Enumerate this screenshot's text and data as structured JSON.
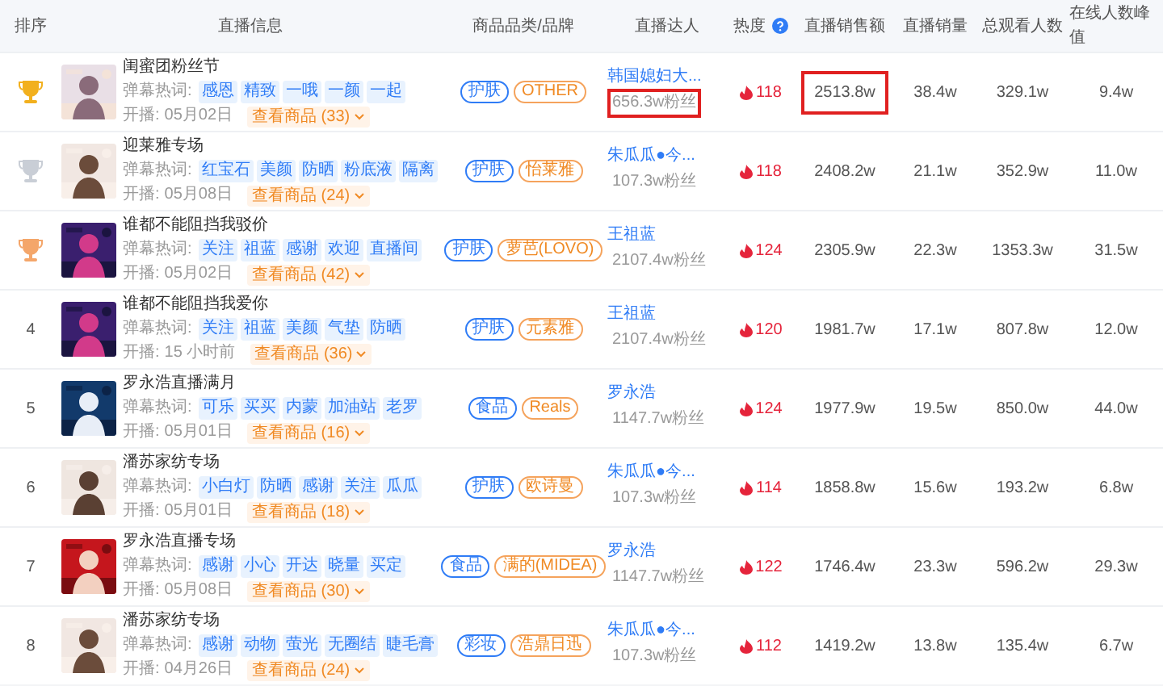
{
  "columns": [
    "排序",
    "直播信息",
    "商品品类/品牌",
    "直播达人",
    "热度",
    "直播销售额",
    "直播销量",
    "总观看人数",
    "在线人数峰值"
  ],
  "rows": [
    {
      "color": "#f2b01e",
      "title": "闺蜜团粉丝节",
      "hot_words_label": "弹幕热词:",
      "tags": [
        "感恩",
        "精致",
        "一哦",
        "一颜",
        "一起"
      ],
      "start_label": "开播:",
      "start": "05月02日",
      "goods": "查看商品 (33)",
      "category": "护肤",
      "brand": "OTHER",
      "anchor": "韩国媳妇大...",
      "fans": "656.3w粉丝",
      "fans_marked": true,
      "heat": "118",
      "sales": "2513.8w",
      "sales_marked": true,
      "volume": "38.4w",
      "viewers": "329.1w",
      "peak": "9.4w"
    },
    {
      "color": "#c9ced6",
      "title": "迎莱雅专场",
      "hot_words_label": "弹幕热词:",
      "tags": [
        "红宝石",
        "美颜",
        "防晒",
        "粉底液",
        "隔离"
      ],
      "start_label": "开播:",
      "start": "05月08日",
      "goods": "查看商品 (24)",
      "category": "护肤",
      "brand": "怡莱雅",
      "anchor": "朱瓜瓜●今...",
      "fans": "107.3w粉丝",
      "fans_marked": false,
      "heat": "118",
      "sales": "2408.2w",
      "sales_marked": false,
      "volume": "21.1w",
      "viewers": "352.9w",
      "peak": "11.0w"
    },
    {
      "color": "#f4a66a",
      "title": "谁都不能阻挡我驳价",
      "hot_words_label": "弹幕热词:",
      "tags": [
        "关注",
        "祖蓝",
        "感谢",
        "欢迎",
        "直播间"
      ],
      "start_label": "开播:",
      "start": "05月02日",
      "goods": "查看商品 (42)",
      "category": "护肤",
      "brand": "萝芭(LOVO)",
      "anchor": "王祖蓝",
      "fans": "2107.4w粉丝",
      "fans_marked": false,
      "heat": "124",
      "sales": "2305.9w",
      "sales_marked": false,
      "volume": "22.3w",
      "viewers": "1353.3w",
      "peak": "31.5w"
    },
    {
      "rank": "4",
      "title": "谁都不能阻挡我爱你",
      "hot_words_label": "弹幕热词:",
      "tags": [
        "关注",
        "祖蓝",
        "美颜",
        "气垫",
        "防晒"
      ],
      "start_label": "开播:",
      "start": "15 小时前",
      "goods": "查看商品 (36)",
      "category": "护肤",
      "brand": "元素雅",
      "anchor": "王祖蓝",
      "fans": "2107.4w粉丝",
      "fans_marked": false,
      "heat": "120",
      "sales": "1981.7w",
      "sales_marked": false,
      "volume": "17.1w",
      "viewers": "807.8w",
      "peak": "12.0w"
    },
    {
      "rank": "5",
      "title": "罗永浩直播满月",
      "hot_words_label": "弹幕热词:",
      "tags": [
        "可乐",
        "买买",
        "内蒙",
        "加油站",
        "老罗"
      ],
      "start_label": "开播:",
      "start": "05月01日",
      "goods": "查看商品 (16)",
      "category": "食品",
      "brand": "Reals",
      "anchor": "罗永浩",
      "fans": "1147.7w粉丝",
      "fans_marked": false,
      "heat": "124",
      "sales": "1977.9w",
      "sales_marked": false,
      "volume": "19.5w",
      "viewers": "850.0w",
      "peak": "44.0w"
    },
    {
      "rank": "6",
      "title": "潘苏家纺专场",
      "hot_words_label": "弹幕热词:",
      "tags": [
        "小白灯",
        "防晒",
        "感谢",
        "关注",
        "瓜瓜"
      ],
      "start_label": "开播:",
      "start": "05月01日",
      "goods": "查看商品 (18)",
      "category": "护肤",
      "brand": "欧诗曼",
      "anchor": "朱瓜瓜●今...",
      "fans": "107.3w粉丝",
      "fans_marked": false,
      "heat": "114",
      "sales": "1858.8w",
      "sales_marked": false,
      "volume": "15.6w",
      "viewers": "193.2w",
      "peak": "6.8w"
    },
    {
      "rank": "7",
      "title": "罗永浩直播专场",
      "hot_words_label": "弹幕热词:",
      "tags": [
        "感谢",
        "小心",
        "开达",
        "晓量",
        "买定"
      ],
      "start_label": "开播:",
      "start": "05月08日",
      "goods": "查看商品 (30)",
      "category": "食品",
      "brand": "满的(MIDEA)",
      "anchor": "罗永浩",
      "fans": "1147.7w粉丝",
      "fans_marked": false,
      "heat": "122",
      "sales": "1746.4w",
      "sales_marked": false,
      "volume": "23.3w",
      "viewers": "596.2w",
      "peak": "29.3w"
    },
    {
      "rank": "8",
      "title": "潘苏家纺专场",
      "hot_words_label": "弹幕热词:",
      "tags": [
        "感谢",
        "动物",
        "萤光",
        "无圈结",
        "睫毛膏"
      ],
      "start_label": "开播:",
      "start": "04月26日",
      "goods": "查看商品 (24)",
      "category": "彩妆",
      "brand": "浩鼎日迅",
      "anchor": "朱瓜瓜●今...",
      "fans": "107.3w粉丝",
      "fans_marked": false,
      "heat": "112",
      "sales": "1419.2w",
      "sales_marked": false,
      "volume": "13.8w",
      "viewers": "135.4w",
      "peak": "6.7w"
    }
  ]
}
